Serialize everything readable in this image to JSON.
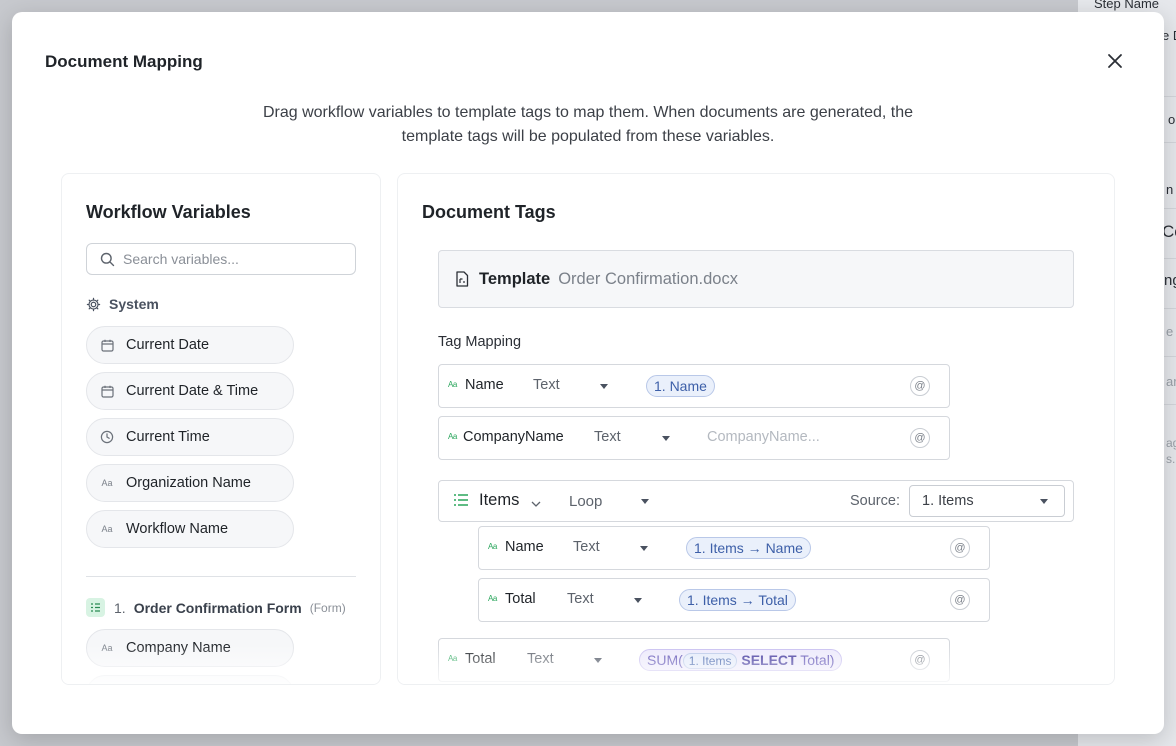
{
  "modal": {
    "title": "Document Mapping",
    "description": "Drag workflow variables to template tags to map them. When documents are generated, the template tags will be populated from these variables."
  },
  "background": {
    "rows": [
      "Step Name",
      "e D",
      "or",
      "n",
      "Co",
      "ng",
      "e",
      "ar",
      "ag",
      "s."
    ]
  },
  "variables": {
    "title": "Workflow Variables",
    "search_placeholder": "Search variables...",
    "system_label": "System",
    "system_items": [
      {
        "label": "Current Date",
        "icon": "calendar-icon"
      },
      {
        "label": "Current Date & Time",
        "icon": "calendar-icon"
      },
      {
        "label": "Current Time",
        "icon": "clock-icon"
      },
      {
        "label": "Organization Name",
        "icon": "text-type-icon"
      },
      {
        "label": "Workflow Name",
        "icon": "text-type-icon"
      }
    ],
    "form": {
      "number": "1.",
      "name": "Order Confirmation Form",
      "type": "(Form)",
      "items": [
        {
          "label": "Company Name",
          "icon": "text-type-icon"
        }
      ]
    }
  },
  "tags": {
    "title": "Document Tags",
    "template_label": "Template",
    "template_file": "Order Confirmation.docx",
    "mapping_label": "Tag Mapping",
    "rows": [
      {
        "name": "Name",
        "type": "Text",
        "chip": "1. Name",
        "placeholder": ""
      },
      {
        "name": "CompanyName",
        "type": "Text",
        "chip": "",
        "placeholder": "CompanyName..."
      }
    ],
    "loop": {
      "name": "Items",
      "type": "Loop",
      "source_label": "Source:",
      "source_value": "1. Items",
      "children": [
        {
          "name": "Name",
          "type": "Text",
          "chip": "1. Items → Name"
        },
        {
          "name": "Total",
          "type": "Text",
          "chip": "1. Items → Total"
        }
      ]
    },
    "total_row": {
      "name": "Total",
      "type": "Text",
      "sum_prefix": "SUM(",
      "sum_inner": "1. Items",
      "sum_keyword": "SELECT",
      "sum_suffix": "Total)"
    }
  },
  "icons": {
    "close": "close-icon",
    "search": "search-icon",
    "system": "gear-icon",
    "form": "form-list-icon",
    "template": "document-icon",
    "loop": "list-icon",
    "mention": "at-icon"
  },
  "colors": {
    "chip_bg": "#eaf0fb",
    "chip_text": "#3d5fa8",
    "form_badge": "#d8f3e3",
    "tag_icon": "#2aa65c"
  }
}
